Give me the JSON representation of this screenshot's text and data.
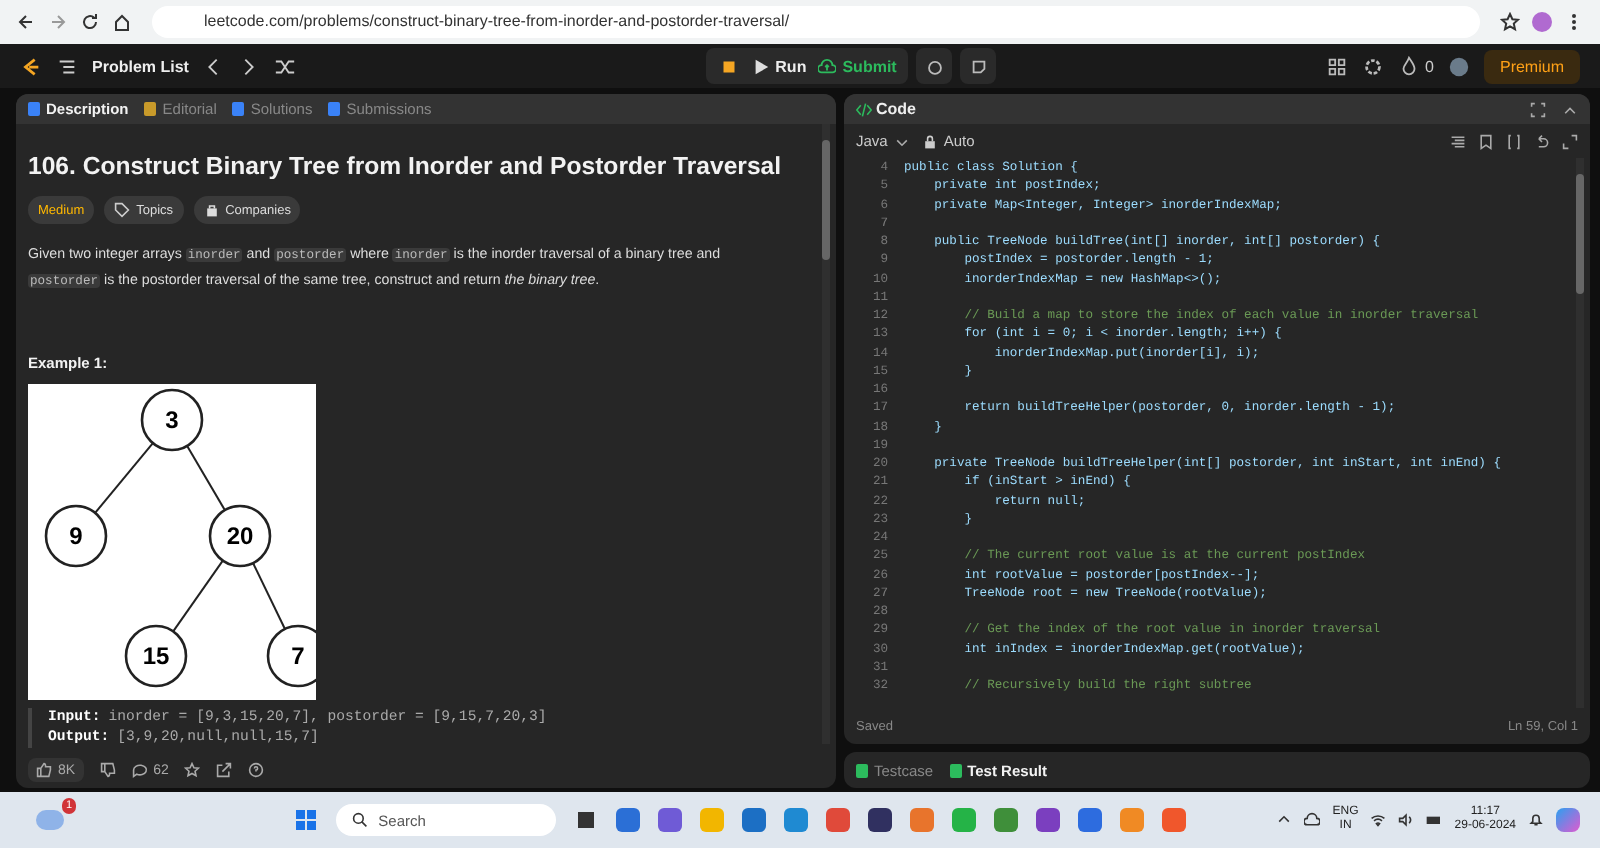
{
  "browser": {
    "url": "leetcode.com/problems/construct-binary-tree-from-inorder-and-postorder-traversal/"
  },
  "nav": {
    "problem_list": "Problem List",
    "run": "Run",
    "submit": "Submit",
    "streak": "0",
    "premium": "Premium"
  },
  "description_tabs": [
    {
      "label": "Description",
      "selected": true
    },
    {
      "label": "Editorial",
      "selected": false
    },
    {
      "label": "Solutions",
      "selected": false
    },
    {
      "label": "Submissions",
      "selected": false
    }
  ],
  "problem": {
    "title": "106. Construct Binary Tree from Inorder and Postorder Traversal",
    "tags": [
      {
        "label": "Medium",
        "kind": "difficulty"
      },
      {
        "label": "Topics",
        "kind": "topics"
      },
      {
        "label": "Companies",
        "kind": "companies"
      }
    ],
    "statement": [
      {
        "text": "Given two integer arrays ",
        "kind": "plain"
      },
      {
        "text": "inorder",
        "kind": "code"
      },
      {
        "text": " and ",
        "kind": "plain"
      },
      {
        "text": "postorder",
        "kind": "code"
      },
      {
        "text": " where ",
        "kind": "plain"
      },
      {
        "text": "inorder",
        "kind": "code"
      },
      {
        "text": " is the inorder traversal of a binary tree and ",
        "kind": "plain"
      },
      {
        "text": "postorder",
        "kind": "code"
      },
      {
        "text": " is the postorder traversal of the same tree, construct and return ",
        "kind": "plain"
      },
      {
        "text": "the binary tree",
        "kind": "italic"
      },
      {
        "text": ".",
        "kind": "plain"
      }
    ],
    "example_title": "Example 1:",
    "tree_nodes": [
      "3",
      "9",
      "20",
      "15",
      "7"
    ],
    "input_label": "Input:",
    "input": "inorder = [9,3,15,20,7], postorder = [9,15,7,20,3]",
    "output_label": "Output:",
    "output": "[3,9,20,null,null,15,7]"
  },
  "footer": {
    "likes": "8K",
    "comments": "62"
  },
  "code_panel": {
    "title": "Code",
    "language": "Java",
    "mode": "Auto",
    "status": "Saved",
    "cursor": "Ln 59, Col 1"
  },
  "code_lines": [
    {
      "number": "4",
      "text": "public class Solution {",
      "kind": "code"
    },
    {
      "number": "5",
      "text": "    private int postIndex;",
      "kind": "code"
    },
    {
      "number": "6",
      "text": "    private Map<Integer, Integer> inorderIndexMap;",
      "kind": "code"
    },
    {
      "number": "7"
    },
    {
      "number": "8",
      "text": "    public TreeNode buildTree(int[] inorder, int[] postorder) {",
      "kind": "code"
    },
    {
      "number": "9",
      "text": "        postIndex = postorder.length - 1;",
      "kind": "code"
    },
    {
      "number": "10",
      "text": "        inorderIndexMap = new HashMap<>();",
      "kind": "code"
    },
    {
      "number": "11"
    },
    {
      "number": "12",
      "text": "        // Build a map to store the index of each value in inorder traversal",
      "kind": "comment"
    },
    {
      "number": "13",
      "text": "        for (int i = 0; i < inorder.length; i++) {",
      "kind": "code"
    },
    {
      "number": "14",
      "text": "            inorderIndexMap.put(inorder[i], i);",
      "kind": "code"
    },
    {
      "number": "15",
      "text": "        }",
      "kind": "code"
    },
    {
      "number": "16"
    },
    {
      "number": "17",
      "text": "        return buildTreeHelper(postorder, 0, inorder.length - 1);",
      "kind": "code"
    },
    {
      "number": "18",
      "text": "    }",
      "kind": "code"
    },
    {
      "number": "19"
    },
    {
      "number": "20",
      "text": "    private TreeNode buildTreeHelper(int[] postorder, int inStart, int inEnd) {",
      "kind": "code"
    },
    {
      "number": "21",
      "text": "        if (inStart > inEnd) {",
      "kind": "code"
    },
    {
      "number": "22",
      "text": "            return null;",
      "kind": "code"
    },
    {
      "number": "23",
      "text": "        }",
      "kind": "code"
    },
    {
      "number": "24"
    },
    {
      "number": "25",
      "text": "        // The current root value is at the current postIndex",
      "kind": "comment"
    },
    {
      "number": "26",
      "text": "        int rootValue = postorder[postIndex--];",
      "kind": "code"
    },
    {
      "number": "27",
      "text": "        TreeNode root = new TreeNode(rootValue);",
      "kind": "code"
    },
    {
      "number": "28"
    },
    {
      "number": "29",
      "text": "        // Get the index of the root value in inorder traversal",
      "kind": "comment"
    },
    {
      "number": "30",
      "text": "        int inIndex = inorderIndexMap.get(rootValue);",
      "kind": "code"
    },
    {
      "number": "31"
    },
    {
      "number": "32",
      "text": "        // Recursively build the right subtree",
      "kind": "comment"
    }
  ],
  "bottom_tabs": [
    {
      "label": "Testcase",
      "selected": false
    },
    {
      "label": "Test Result",
      "selected": true
    }
  ],
  "taskbar": {
    "weather_badge": "1",
    "search_placeholder": "Search",
    "language": "ENG",
    "region": "IN",
    "time": "11:17",
    "date": "29-06-2024",
    "apps": [
      {
        "color": "#2b6fd6"
      },
      {
        "color": "#6f5bd6"
      },
      {
        "color": "#f2b600"
      },
      {
        "color": "#1c6fc4"
      },
      {
        "color": "#1f8ad2"
      },
      {
        "color": "#e04a3a"
      },
      {
        "color": "#303060"
      },
      {
        "color": "#e8742c"
      },
      {
        "color": "#25b347"
      },
      {
        "color": "#3f8f3a"
      },
      {
        "color": "#7b3fbf"
      },
      {
        "color": "#2d6cdf"
      },
      {
        "color": "#f08a24"
      },
      {
        "color": "#f0572c"
      }
    ]
  }
}
